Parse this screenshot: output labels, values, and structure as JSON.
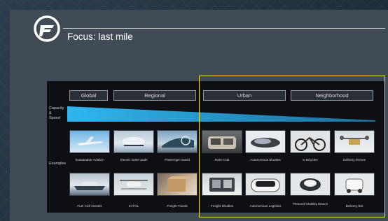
{
  "slide": {
    "title": "Focus: last mile",
    "highlight_color": "#f2dc2a",
    "logo_icon": "circle-f-logo"
  },
  "scopes": [
    "Global",
    "Regional",
    "Urban",
    "Neighborhood"
  ],
  "row_labels": {
    "capacity": "Capacity\n&\nSpeed",
    "examples": "Examples"
  },
  "examples_row1": [
    "Sustainable Aviation",
    "Electric water pods",
    "Passenger transit",
    "Robo Cab",
    "Autonomous Shuttles",
    "E-Bicycles",
    "Delivery drones"
  ],
  "examples_row2": [
    "Fuel Cell Vessels",
    "eVTOL",
    "Freight Transit",
    "Freight Shuttles",
    "Autonomous Logistics",
    "Personal Mobility Device",
    "Delivery Bot"
  ]
}
